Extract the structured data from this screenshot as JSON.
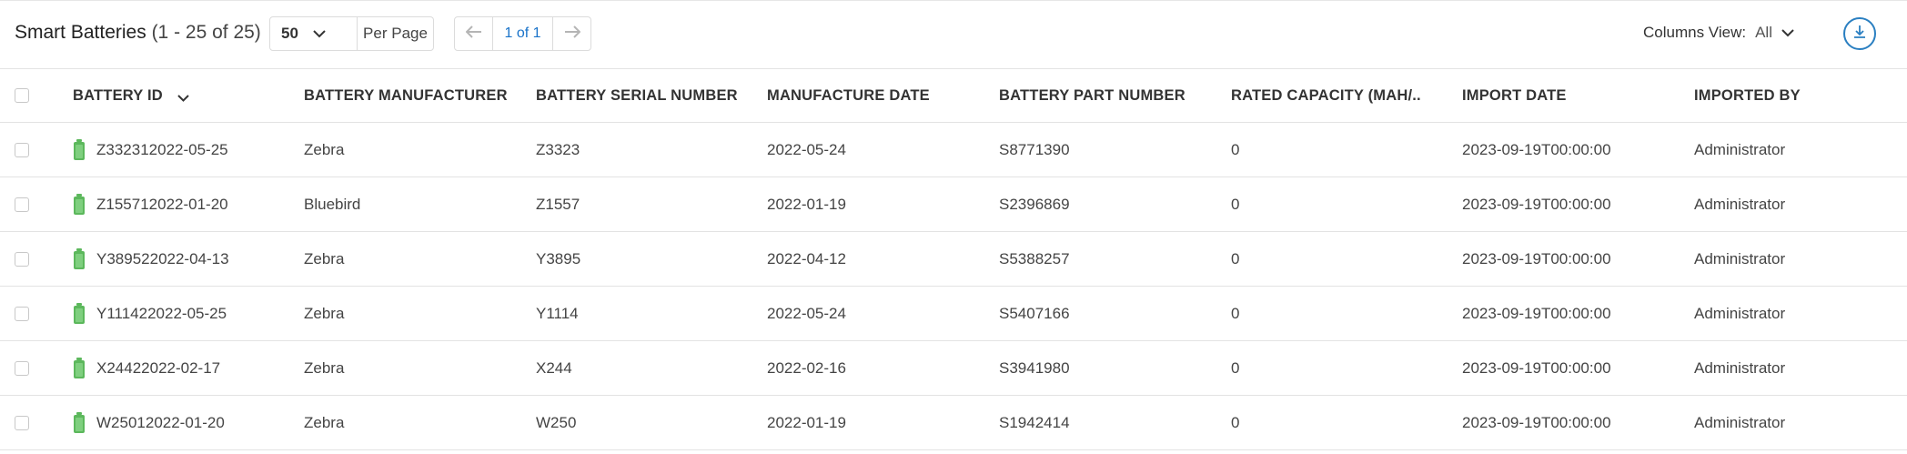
{
  "toolbar": {
    "title": "Smart Batteries",
    "count": "(1 - 25 of 25)",
    "per_page_value": "50",
    "per_page_label": "Per Page",
    "page_indicator": "1 of 1",
    "columns_view_label": "Columns View:",
    "columns_view_value": "All"
  },
  "columns": [
    "BATTERY ID",
    "BATTERY MANUFACTURER",
    "BATTERY SERIAL NUMBER",
    "MANUFACTURE DATE",
    "BATTERY PART NUMBER",
    "RATED CAPACITY (MAH/...",
    "IMPORT DATE",
    "IMPORTED BY"
  ],
  "rows": [
    {
      "id": "Z332312022-05-25",
      "manufacturer": "Zebra",
      "serial": "Z3323",
      "mfg_date": "2022-05-24",
      "part": "S8771390",
      "capacity": "0",
      "import_date": "2023-09-19T00:00:00",
      "imported_by": "Administrator"
    },
    {
      "id": "Z155712022-01-20",
      "manufacturer": "Bluebird",
      "serial": "Z1557",
      "mfg_date": "2022-01-19",
      "part": "S2396869",
      "capacity": "0",
      "import_date": "2023-09-19T00:00:00",
      "imported_by": "Administrator"
    },
    {
      "id": "Y389522022-04-13",
      "manufacturer": "Zebra",
      "serial": "Y3895",
      "mfg_date": "2022-04-12",
      "part": "S5388257",
      "capacity": "0",
      "import_date": "2023-09-19T00:00:00",
      "imported_by": "Administrator"
    },
    {
      "id": "Y111422022-05-25",
      "manufacturer": "Zebra",
      "serial": "Y1114",
      "mfg_date": "2022-05-24",
      "part": "S5407166",
      "capacity": "0",
      "import_date": "2023-09-19T00:00:00",
      "imported_by": "Administrator"
    },
    {
      "id": "X24422022-02-17",
      "manufacturer": "Zebra",
      "serial": "X244",
      "mfg_date": "2022-02-16",
      "part": "S3941980",
      "capacity": "0",
      "import_date": "2023-09-19T00:00:00",
      "imported_by": "Administrator"
    },
    {
      "id": "W25012022-01-20",
      "manufacturer": "Zebra",
      "serial": "W250",
      "mfg_date": "2022-01-19",
      "part": "S1942414",
      "capacity": "0",
      "import_date": "2023-09-19T00:00:00",
      "imported_by": "Administrator"
    }
  ],
  "icons": {
    "battery": "battery-icon",
    "sort": "chevron-down-icon",
    "prev": "arrow-left-icon",
    "next": "arrow-right-icon",
    "dropdown": "chevron-down-icon",
    "download": "download-icon"
  },
  "colors": {
    "accent": "#2a7fc1",
    "battery": "#5cb85c",
    "border": "#e3e3e3"
  }
}
